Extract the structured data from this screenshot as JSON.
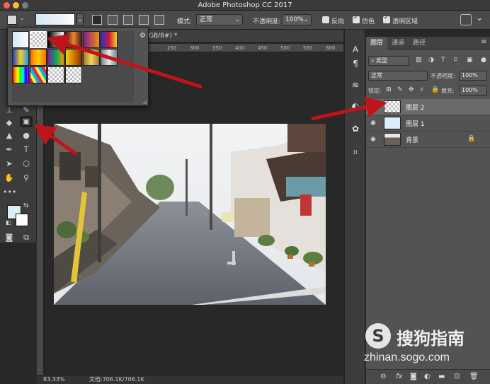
{
  "app_title": "Adobe Photoshop CC 2017",
  "options_bar": {
    "mode_label": "模式:",
    "mode_value": "正常",
    "opacity_label": "不透明度:",
    "opacity_value": "100%",
    "reverse_label": "反向",
    "dither_label": "仿色",
    "transparency_label": "透明区域"
  },
  "document": {
    "tab_title_fragment": "GB/8#) *",
    "ruler_ticks": [
      "250",
      "300",
      "350",
      "400",
      "450",
      "500",
      "550",
      "600",
      "650",
      "700",
      "750",
      "800",
      "850"
    ],
    "zoom": "83.33%",
    "doc_info": "文档:706.1K/706.1K"
  },
  "layers_panel": {
    "tabs": [
      "图层",
      "通道",
      "路径"
    ],
    "filter_label": "类型",
    "blend_mode": "正常",
    "opacity_label": "不透明度:",
    "opacity_value": "100%",
    "lock_label": "锁定:",
    "fill_label": "填充:",
    "fill_value": "100%",
    "layers": [
      {
        "name": "图层 2",
        "selected": true
      },
      {
        "name": "图层 1",
        "selected": false
      },
      {
        "name": "背景",
        "selected": false
      }
    ]
  },
  "watermark": {
    "logo_letter": "S",
    "name": "搜狗指南",
    "url": "zhinan.sogo.com"
  },
  "colors": {
    "arrow": "#c0141a",
    "foreground": "#dbeefa",
    "background": "#ffffff"
  }
}
